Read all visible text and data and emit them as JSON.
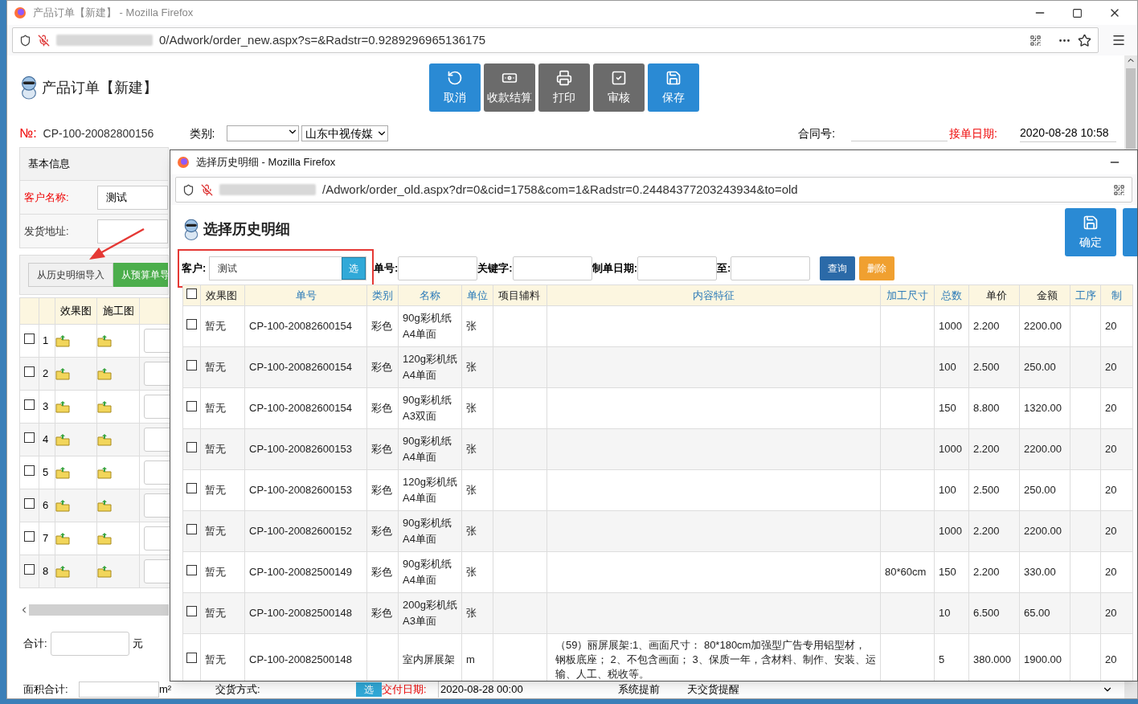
{
  "window": {
    "title": "产品订单【新建】 - Mozilla Firefox",
    "url": "0/Adwork/order_new.aspx?s=&Radstr=0.9289296965136175"
  },
  "page": {
    "title": "产品订单【新建】",
    "toolbar": [
      {
        "label": "取消",
        "kind": "primary"
      },
      {
        "label": "收款结算",
        "kind": "secondary"
      },
      {
        "label": "打印",
        "kind": "secondary"
      },
      {
        "label": "审核",
        "kind": "secondary"
      },
      {
        "label": "保存",
        "kind": "primary"
      }
    ],
    "order": {
      "no_label": "№:",
      "no_value": "CP-100-20082800156",
      "category_label": "类别:",
      "company": "山东中视传媒",
      "contract_label": "合同号:",
      "date_label": "接单日期:",
      "date_value": "2020-08-28 10:58"
    },
    "basic_info": {
      "heading": "基本信息",
      "fields": [
        {
          "label": "客户名称:",
          "value": "测试",
          "required": true
        },
        {
          "label": "发货地址:",
          "required": false
        }
      ]
    },
    "import_buttons": [
      {
        "label": "从历史明细导入",
        "kind": "default"
      },
      {
        "label": "从预算单导",
        "kind": "success"
      }
    ],
    "detail_table": {
      "columns": [
        "效果图",
        "施工图"
      ],
      "rows": [
        {
          "no": "1",
          "checked": false
        },
        {
          "no": "2",
          "checked": false
        },
        {
          "no": "3",
          "checked": false
        },
        {
          "no": "4",
          "checked": false
        },
        {
          "no": "5",
          "checked": false
        },
        {
          "no": "6",
          "checked": false
        },
        {
          "no": "7",
          "checked": false
        },
        {
          "no": "8",
          "checked": false
        }
      ]
    },
    "total": {
      "label": "合计:",
      "unit": "元"
    },
    "bottom_row": {
      "area_label": "面积合计:",
      "area_unit": "m²",
      "delivery_label": "交货方式:",
      "pick": "选",
      "due_label": "交付日期:",
      "due_value": "2020-08-28 00:00",
      "remind_before": "系统提前",
      "remind_after": "天交货提醒"
    }
  },
  "popup": {
    "title": "选择历史明细 - Mozilla Firefox",
    "url": "/Adwork/order_old.aspx?dr=0&cid=1758&com=1&Radstr=0.24484377203243934&to=old",
    "heading": "选择历史明细",
    "confirm": "确定",
    "search": {
      "customer_label": "客户:",
      "customer_value": "测试",
      "pick": "选",
      "fields": [
        {
          "label": "单号:"
        },
        {
          "label": "关键字:"
        },
        {
          "label": "制单日期:"
        },
        {
          "label": "至:"
        }
      ],
      "query": "查询",
      "delete": "删除"
    },
    "table": {
      "all_checked": false,
      "columns": [
        {
          "label": "效果图",
          "kind": "plain"
        },
        {
          "label": "单号",
          "kind": "link"
        },
        {
          "label": "类别",
          "kind": "link"
        },
        {
          "label": "名称",
          "kind": "link"
        },
        {
          "label": "单位",
          "kind": "link"
        },
        {
          "label": "项目辅料",
          "kind": "plain"
        },
        {
          "label": "内容特征",
          "kind": "link"
        },
        {
          "label": "加工尺寸",
          "kind": "link"
        },
        {
          "label": "总数",
          "kind": "link"
        },
        {
          "label": "单价",
          "kind": "plain"
        },
        {
          "label": "金额",
          "kind": "plain"
        },
        {
          "label": "工序",
          "kind": "link"
        },
        {
          "label": "制",
          "kind": "link"
        }
      ],
      "rows": [
        {
          "checked": false,
          "cells": [
            "暂无",
            "CP-100-20082600154",
            "彩色",
            "90g彩机纸A4单面",
            "张",
            "",
            "",
            "",
            "1000",
            "2.200",
            "2200.00",
            "",
            "20"
          ]
        },
        {
          "checked": false,
          "cells": [
            "暂无",
            "CP-100-20082600154",
            "彩色",
            "120g彩机纸 A4单面",
            "张",
            "",
            "",
            "",
            "100",
            "2.500",
            "250.00",
            "",
            "20"
          ]
        },
        {
          "checked": false,
          "cells": [
            "暂无",
            "CP-100-20082600154",
            "彩色",
            "90g彩机纸A3双面",
            "张",
            "",
            "",
            "",
            "150",
            "8.800",
            "1320.00",
            "",
            "20"
          ]
        },
        {
          "checked": false,
          "cells": [
            "暂无",
            "CP-100-20082600153",
            "彩色",
            "90g彩机纸A4单面",
            "张",
            "",
            "",
            "",
            "1000",
            "2.200",
            "2200.00",
            "",
            "20"
          ]
        },
        {
          "checked": false,
          "cells": [
            "暂无",
            "CP-100-20082600153",
            "彩色",
            "120g彩机纸 A4单面",
            "张",
            "",
            "",
            "",
            "100",
            "2.500",
            "250.00",
            "",
            "20"
          ]
        },
        {
          "checked": false,
          "cells": [
            "暂无",
            "CP-100-20082600152",
            "彩色",
            "90g彩机纸A4单面",
            "张",
            "",
            "",
            "",
            "1000",
            "2.200",
            "2200.00",
            "",
            "20"
          ]
        },
        {
          "checked": false,
          "cells": [
            "暂无",
            "CP-100-20082500149",
            "彩色",
            "90g彩机纸A4单面",
            "张",
            "",
            "",
            "80*60cm",
            "150",
            "2.200",
            "330.00",
            "",
            "20"
          ]
        },
        {
          "checked": false,
          "cells": [
            "暂无",
            "CP-100-20082500148",
            "彩色",
            "200g彩机纸A3单面",
            "张",
            "",
            "",
            "",
            "10",
            "6.500",
            "65.00",
            "",
            "20"
          ]
        },
        {
          "checked": false,
          "cells": [
            "暂无",
            "CP-100-20082500148",
            "",
            "室内屏展架",
            "m",
            "",
            "（59）丽屏展架:1、画面尺寸： 80*180cm加强型广告专用铝型材，钢板底座； 2、不包含画面； 3、保质一年，含材料、制作、安装、运输、人工、税收等。",
            "",
            "5",
            "380.000",
            "1900.00",
            "",
            "20"
          ]
        }
      ]
    }
  }
}
